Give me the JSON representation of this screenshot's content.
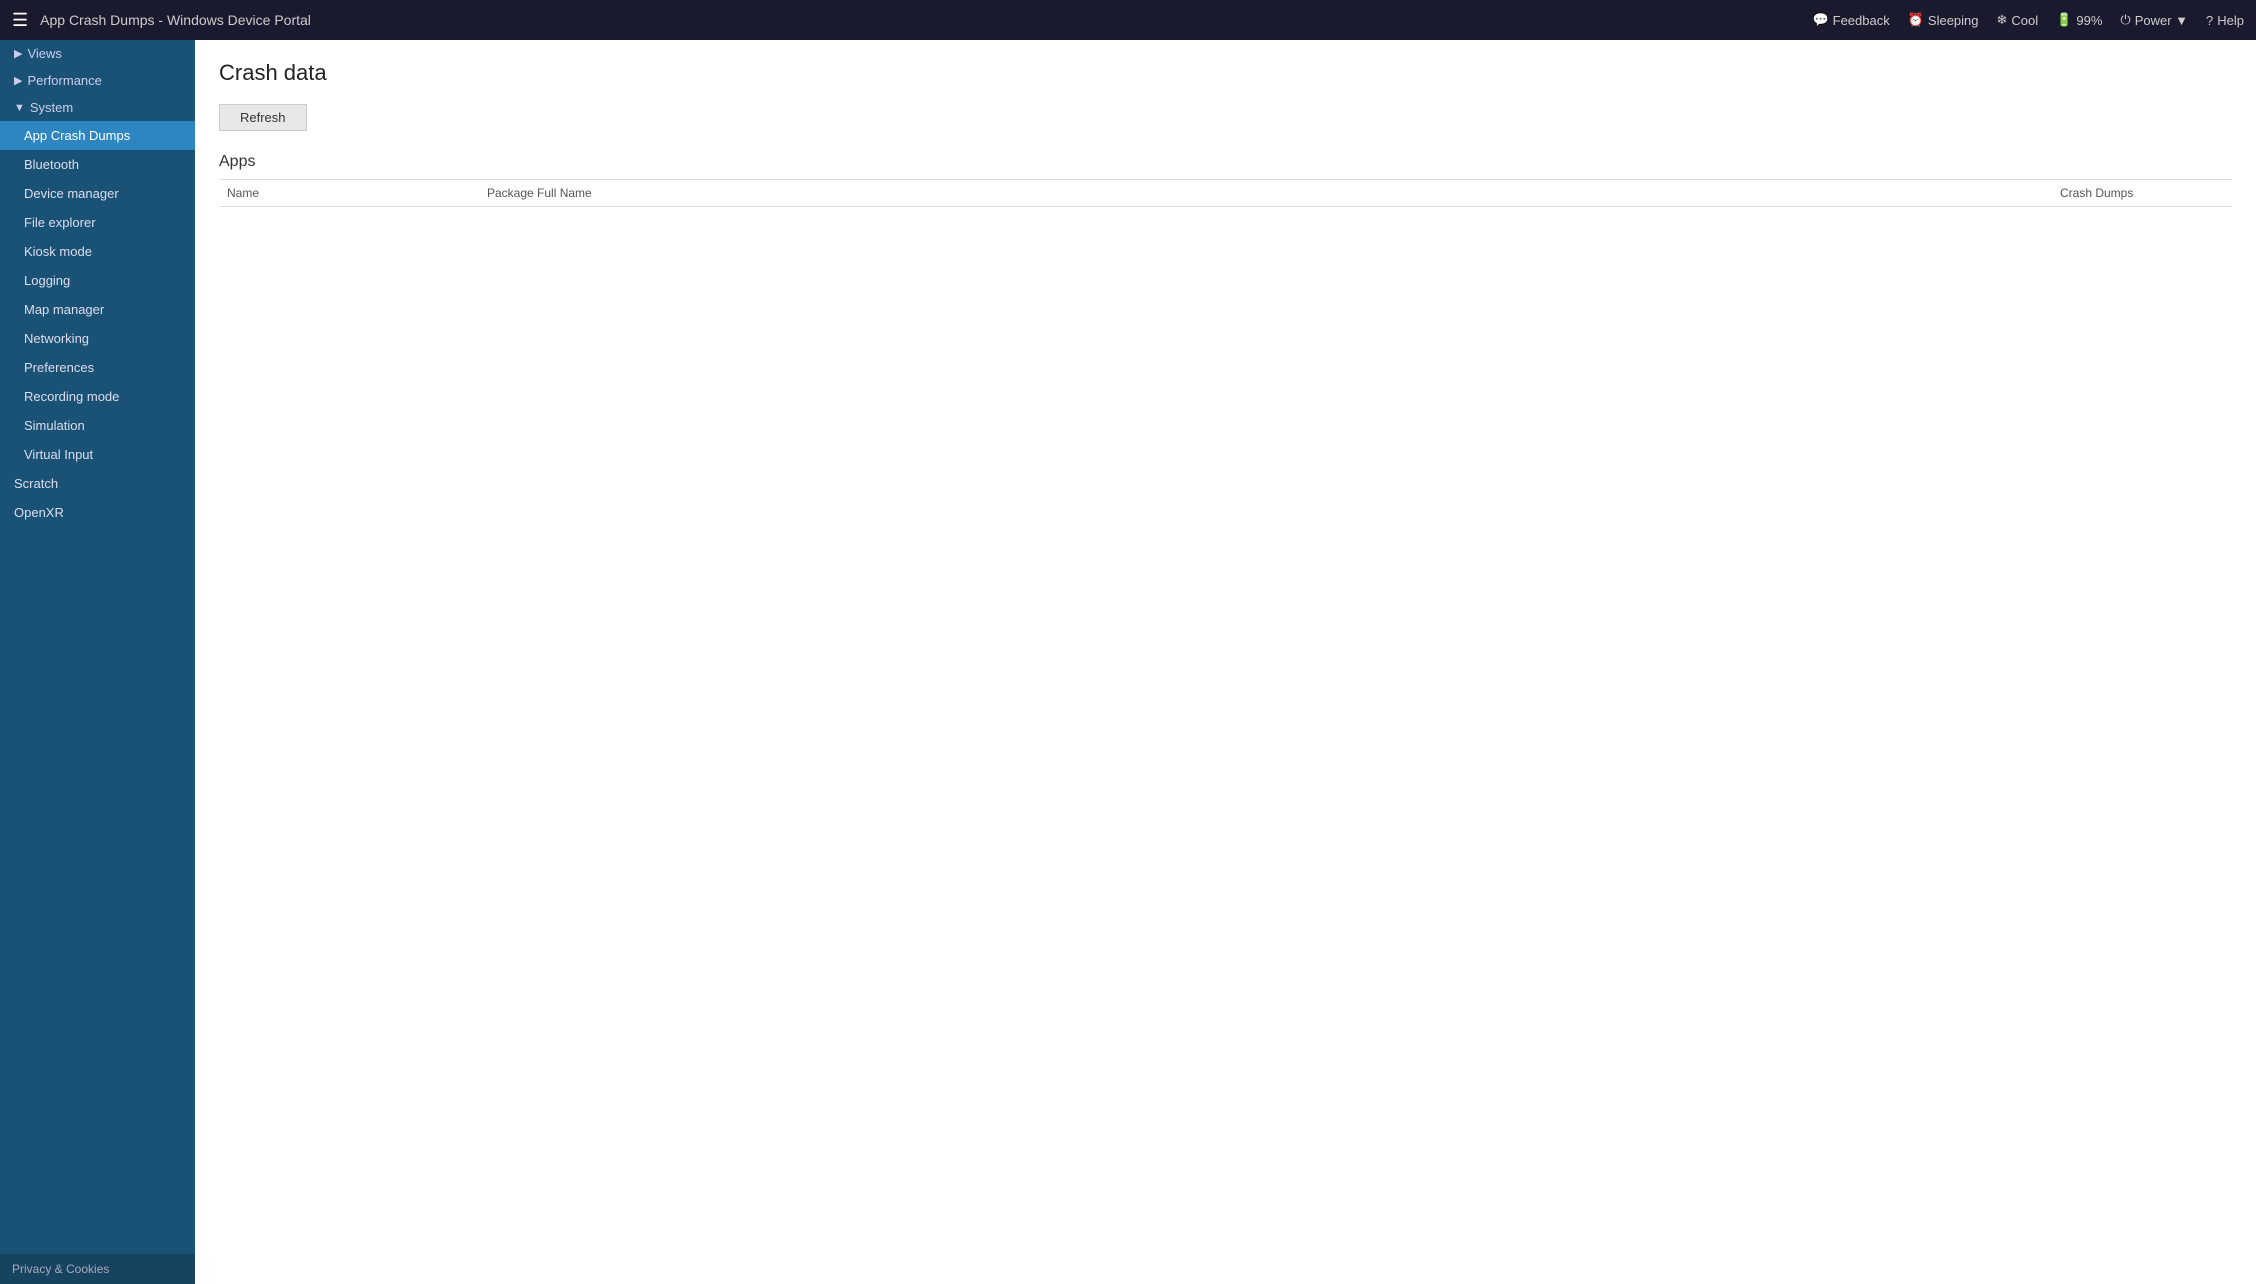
{
  "header": {
    "menu_icon": "☰",
    "title": "App Crash Dumps - Windows Device Portal",
    "actions": [
      {
        "id": "feedback",
        "icon": "💬",
        "label": "Feedback"
      },
      {
        "id": "sleeping",
        "icon": "⏰",
        "label": "Sleeping"
      },
      {
        "id": "cool",
        "icon": "❄",
        "label": "Cool"
      },
      {
        "id": "battery",
        "icon": "🔋",
        "label": "99%"
      },
      {
        "id": "power",
        "icon": "⏻",
        "label": "Power ▼"
      },
      {
        "id": "help",
        "icon": "?",
        "label": "Help"
      }
    ]
  },
  "sidebar": {
    "collapse_icon": "◀",
    "groups": [
      {
        "id": "views",
        "label": "Views",
        "arrow": "▶",
        "expanded": false,
        "items": []
      },
      {
        "id": "performance",
        "label": "Performance",
        "arrow": "▶",
        "expanded": false,
        "items": []
      },
      {
        "id": "system",
        "label": "System",
        "arrow": "▼",
        "expanded": true,
        "items": [
          {
            "id": "app-crash-dumps",
            "label": "App Crash Dumps",
            "active": true
          },
          {
            "id": "bluetooth",
            "label": "Bluetooth",
            "active": false
          },
          {
            "id": "device-manager",
            "label": "Device manager",
            "active": false
          },
          {
            "id": "file-explorer",
            "label": "File explorer",
            "active": false
          },
          {
            "id": "kiosk-mode",
            "label": "Kiosk mode",
            "active": false
          },
          {
            "id": "logging",
            "label": "Logging",
            "active": false
          },
          {
            "id": "map-manager",
            "label": "Map manager",
            "active": false
          },
          {
            "id": "networking",
            "label": "Networking",
            "active": false
          },
          {
            "id": "preferences",
            "label": "Preferences",
            "active": false
          },
          {
            "id": "recording-mode",
            "label": "Recording mode",
            "active": false
          },
          {
            "id": "simulation",
            "label": "Simulation",
            "active": false
          },
          {
            "id": "virtual-input",
            "label": "Virtual Input",
            "active": false
          }
        ]
      }
    ],
    "top_items": [
      {
        "id": "scratch",
        "label": "Scratch"
      },
      {
        "id": "openxr",
        "label": "OpenXR"
      }
    ],
    "footer": "Privacy & Cookies"
  },
  "content": {
    "title": "Crash data",
    "refresh_label": "Refresh",
    "apps_section": "Apps",
    "table": {
      "columns": [
        {
          "id": "name",
          "label": "Name"
        },
        {
          "id": "package",
          "label": "Package Full Name"
        },
        {
          "id": "crashes",
          "label": "Crash Dumps"
        }
      ],
      "rows": []
    }
  }
}
